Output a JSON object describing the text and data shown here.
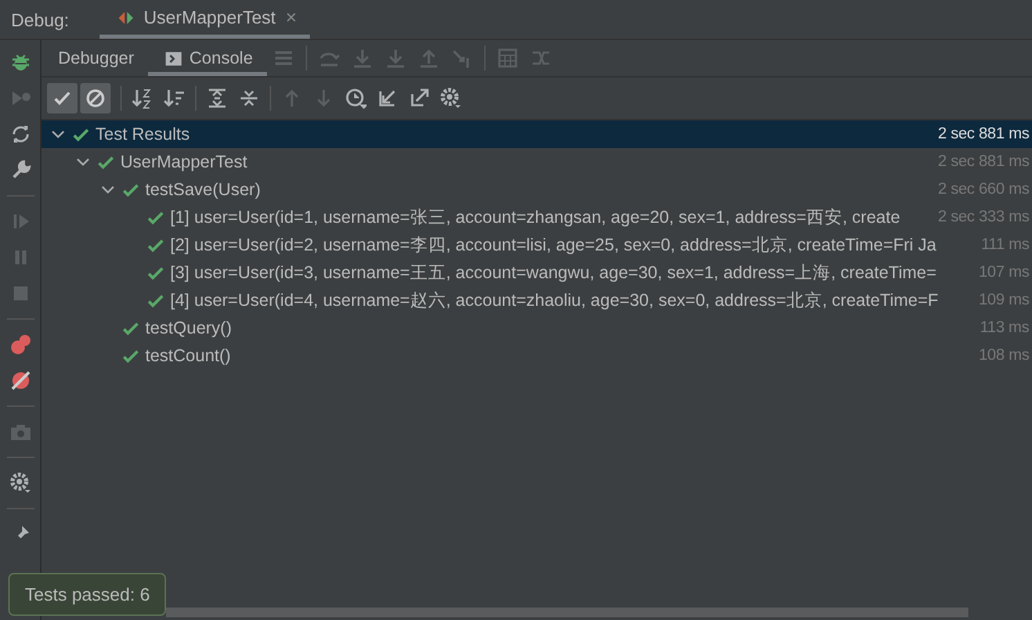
{
  "header": {
    "label": "Debug:",
    "tab": {
      "title": "UserMapperTest",
      "selected": true
    }
  },
  "view_tabs": [
    {
      "label": "Debugger",
      "selected": false,
      "kind": "plain"
    },
    {
      "label": "Console",
      "selected": true,
      "kind": "console"
    }
  ],
  "filter_toggles": [
    {
      "kind": "passed",
      "selected": true
    },
    {
      "kind": "ignored",
      "selected": true
    }
  ],
  "tree": [
    {
      "label": "Test Results",
      "duration": "2 sec 881 ms",
      "passed": true,
      "selected": true,
      "expanded": true,
      "children": [
        {
          "label": "UserMapperTest",
          "duration": "2 sec 881 ms",
          "passed": true,
          "selected": false,
          "expanded": true,
          "children": [
            {
              "label": "testSave(User)",
              "duration": "2 sec 660 ms",
              "passed": true,
              "selected": false,
              "expanded": true,
              "children": [
                {
                  "label": "[1] user=User(id=1, username=张三, account=zhangsan, age=20, sex=1, address=西安, create",
                  "duration": "2 sec 333 ms",
                  "passed": true,
                  "selected": false
                },
                {
                  "label": "[2] user=User(id=2, username=李四, account=lisi, age=25, sex=0, address=北京, createTime=Fri Ja",
                  "duration": "111 ms",
                  "passed": true,
                  "selected": false
                },
                {
                  "label": "[3] user=User(id=3, username=王五, account=wangwu, age=30, sex=1, address=上海, createTime=",
                  "duration": "107 ms",
                  "passed": true,
                  "selected": false
                },
                {
                  "label": "[4] user=User(id=4, username=赵六, account=zhaoliu, age=30, sex=0, address=北京, createTime=F",
                  "duration": "109 ms",
                  "passed": true,
                  "selected": false
                }
              ]
            },
            {
              "label": "testQuery()",
              "duration": "113 ms",
              "passed": true,
              "selected": false
            },
            {
              "label": "testCount()",
              "duration": "108 ms",
              "passed": true,
              "selected": false
            }
          ]
        }
      ]
    }
  ],
  "toast": "Tests passed: 6"
}
